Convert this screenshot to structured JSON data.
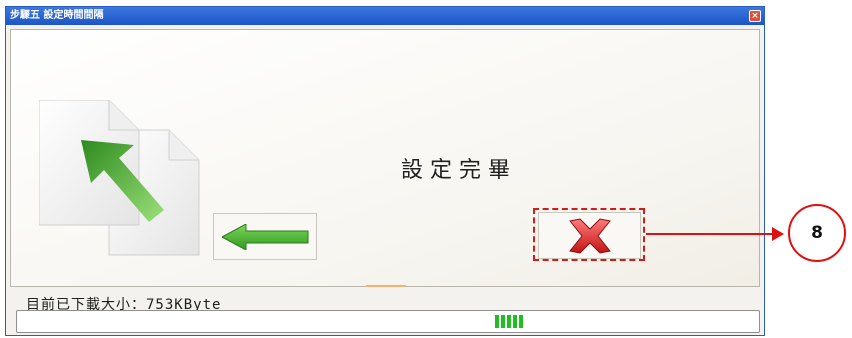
{
  "window": {
    "title": "步驟五 設定時間間隔",
    "close_glyph": "×"
  },
  "main": {
    "message": "設定完畢",
    "back_button_icon": "left-arrow-icon",
    "cancel_button_icon": "red-x-icon"
  },
  "status": {
    "downloaded_text": "目前已下載大小：753KByte"
  },
  "progress": {
    "fraction": 0.03
  },
  "annotation": {
    "step_number": "8",
    "color": "#e01010"
  }
}
